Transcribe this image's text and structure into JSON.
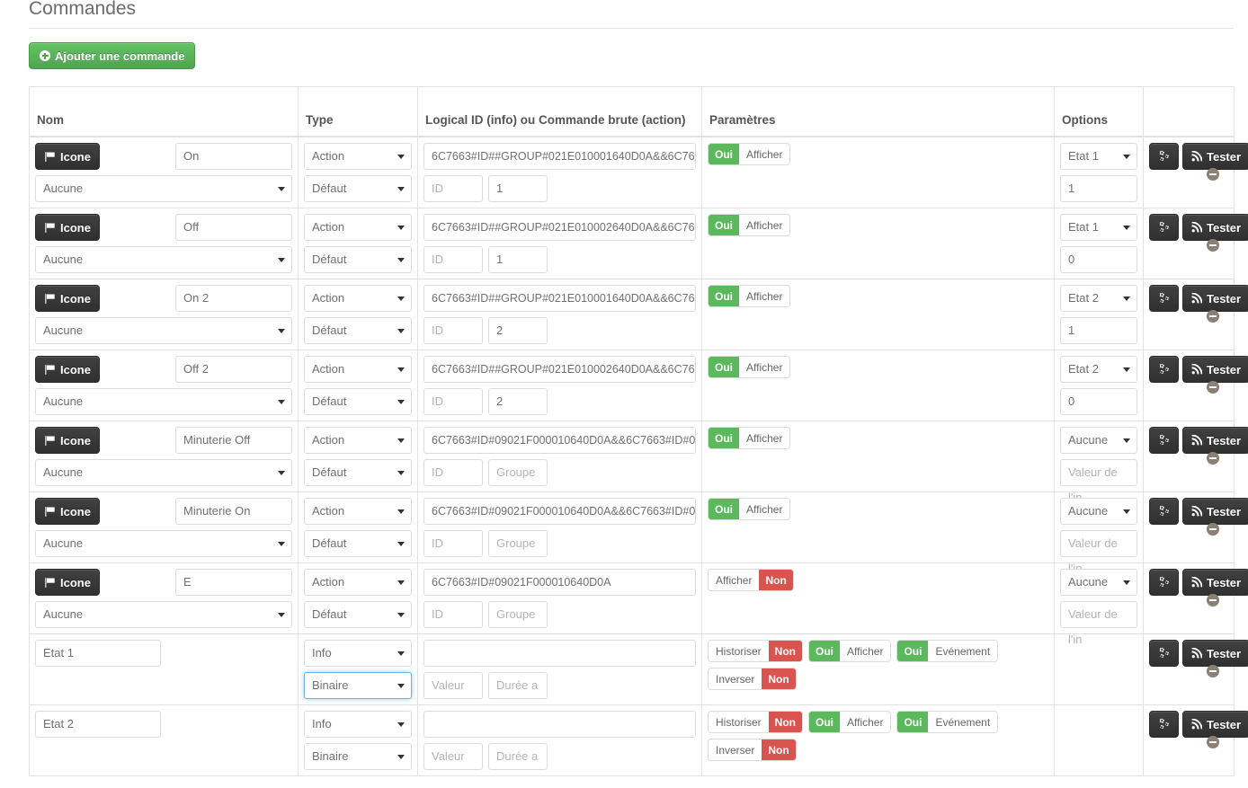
{
  "page": {
    "legend": "Commandes",
    "add_button": "Ajouter une commande"
  },
  "table": {
    "headers": {
      "nom": "Nom",
      "type": "Type",
      "logical_id": "Logical ID (info) ou Commande brute (action)",
      "parametres": "Paramètres",
      "options": "Options",
      "actions": ""
    },
    "labels": {
      "icone": "Icone",
      "tester": "Tester"
    },
    "rows": [
      {
        "kind": "action",
        "icon_button": "Icone",
        "name": "On",
        "sub_select": "Aucune",
        "type": "Action",
        "subtype": "Défaut",
        "logical_id": "6C7663#ID##GROUP#021E010001640D0A&&6C76",
        "param_id_placeholder": "ID",
        "param_value": "1",
        "param_value_placeholder": "",
        "toggles": [
          {
            "state": "oui",
            "state_label": "Oui",
            "label": "Afficher",
            "order": "state-first"
          }
        ],
        "option_select": "Etat 1",
        "option_value": "1",
        "option_value_placeholder": "",
        "tester": "Tester"
      },
      {
        "kind": "action",
        "icon_button": "Icone",
        "name": "Off",
        "sub_select": "Aucune",
        "type": "Action",
        "subtype": "Défaut",
        "logical_id": "6C7663#ID##GROUP#021E010002640D0A&&6C76",
        "param_id_placeholder": "ID",
        "param_value": "1",
        "param_value_placeholder": "",
        "toggles": [
          {
            "state": "oui",
            "state_label": "Oui",
            "label": "Afficher",
            "order": "state-first"
          }
        ],
        "option_select": "Etat 1",
        "option_value": "0",
        "option_value_placeholder": "",
        "tester": "Tester"
      },
      {
        "kind": "action",
        "icon_button": "Icone",
        "name": "On 2",
        "sub_select": "Aucune",
        "type": "Action",
        "subtype": "Défaut",
        "logical_id": "6C7663#ID##GROUP#021E010001640D0A&&6C76",
        "param_id_placeholder": "ID",
        "param_value": "2",
        "param_value_placeholder": "",
        "toggles": [
          {
            "state": "oui",
            "state_label": "Oui",
            "label": "Afficher",
            "order": "state-first"
          }
        ],
        "option_select": "Etat 2",
        "option_value": "1",
        "option_value_placeholder": "",
        "tester": "Tester"
      },
      {
        "kind": "action",
        "icon_button": "Icone",
        "name": "Off 2",
        "sub_select": "Aucune",
        "type": "Action",
        "subtype": "Défaut",
        "logical_id": "6C7663#ID##GROUP#021E010002640D0A&&6C76",
        "param_id_placeholder": "ID",
        "param_value": "2",
        "param_value_placeholder": "",
        "toggles": [
          {
            "state": "oui",
            "state_label": "Oui",
            "label": "Afficher",
            "order": "state-first"
          }
        ],
        "option_select": "Etat 2",
        "option_value": "0",
        "option_value_placeholder": "",
        "tester": "Tester"
      },
      {
        "kind": "action",
        "icon_button": "Icone",
        "name": "Minuterie Off",
        "sub_select": "Aucune",
        "type": "Action",
        "subtype": "Défaut",
        "logical_id": "6C7663#ID#09021F000010640D0A&&6C7663#ID#0",
        "param_id_placeholder": "ID",
        "param_value": "",
        "param_value_placeholder": "Groupe",
        "toggles": [
          {
            "state": "oui",
            "state_label": "Oui",
            "label": "Afficher",
            "order": "state-first"
          }
        ],
        "option_select": "Aucune",
        "option_value": "",
        "option_value_placeholder": "Valeur de l'in",
        "tester": "Tester"
      },
      {
        "kind": "action",
        "icon_button": "Icone",
        "name": "Minuterie On",
        "sub_select": "Aucune",
        "type": "Action",
        "subtype": "Défaut",
        "logical_id": "6C7663#ID#09021F000010640D0A&&6C7663#ID#0",
        "param_id_placeholder": "ID",
        "param_value": "",
        "param_value_placeholder": "Groupe",
        "toggles": [
          {
            "state": "oui",
            "state_label": "Oui",
            "label": "Afficher",
            "order": "state-first"
          }
        ],
        "option_select": "Aucune",
        "option_value": "",
        "option_value_placeholder": "Valeur de l'in",
        "tester": "Tester"
      },
      {
        "kind": "action",
        "icon_button": "Icone",
        "name": "E",
        "sub_select": "Aucune",
        "type": "Action",
        "subtype": "Défaut",
        "logical_id": "6C7663#ID#09021F000010640D0A",
        "param_id_placeholder": "ID",
        "param_value": "",
        "param_value_placeholder": "Groupe",
        "toggles": [
          {
            "state": "non",
            "state_label": "Non",
            "label": "Afficher",
            "order": "label-first"
          }
        ],
        "option_select": "Aucune",
        "option_value": "",
        "option_value_placeholder": "Valeur de l'in",
        "tester": "Tester"
      },
      {
        "kind": "info",
        "name": "Etat 1",
        "type": "Info",
        "subtype": "Binaire",
        "subtype_focused": true,
        "logical_id": "",
        "param_id_placeholder": "Valeur",
        "param_value": "",
        "param_value_placeholder": "Durée a",
        "toggles": [
          {
            "state": "non",
            "state_label": "Non",
            "label": "Historiser",
            "order": "label-first"
          },
          {
            "state": "oui",
            "state_label": "Oui",
            "label": "Afficher",
            "order": "state-first"
          },
          {
            "state": "oui",
            "state_label": "Oui",
            "label": "Evénement",
            "order": "state-first"
          },
          {
            "state": "non",
            "state_label": "Non",
            "label": "Inverser",
            "order": "label-first"
          }
        ],
        "option_select": "",
        "option_value": "",
        "tester": "Tester"
      },
      {
        "kind": "info",
        "name": "Etat 2",
        "type": "Info",
        "subtype": "Binaire",
        "subtype_focused": false,
        "logical_id": "",
        "param_id_placeholder": "Valeur",
        "param_value": "",
        "param_value_placeholder": "Durée a",
        "toggles": [
          {
            "state": "non",
            "state_label": "Non",
            "label": "Historiser",
            "order": "label-first"
          },
          {
            "state": "oui",
            "state_label": "Oui",
            "label": "Afficher",
            "order": "state-first"
          },
          {
            "state": "oui",
            "state_label": "Oui",
            "label": "Evénement",
            "order": "state-first"
          },
          {
            "state": "non",
            "state_label": "Non",
            "label": "Inverser",
            "order": "label-first"
          }
        ],
        "option_select": "",
        "option_value": "",
        "tester": "Tester"
      }
    ]
  },
  "colors": {
    "green": "#5cb85c",
    "red": "#d9534f",
    "dark": "#303030",
    "border": "#e3e3e3"
  }
}
